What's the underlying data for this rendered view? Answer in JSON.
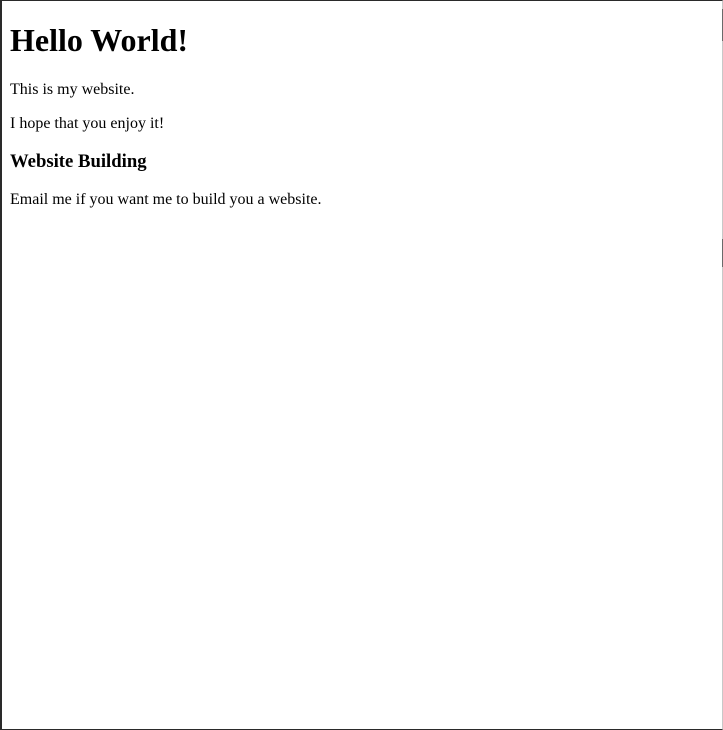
{
  "page": {
    "heading": "Hello World!",
    "intro": "This is my website.",
    "enjoy": "I hope that you enjoy it!",
    "section_heading": "Website Building",
    "section_text": "Email me if you want me to build you a website."
  }
}
